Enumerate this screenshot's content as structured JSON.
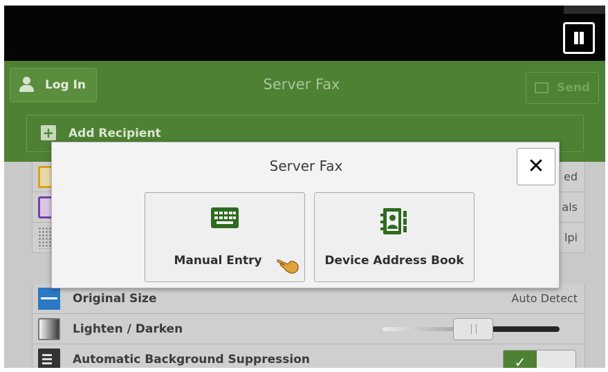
{
  "header": {
    "login_label": "Log In",
    "title": "Server Fax",
    "send_label": "Send"
  },
  "add_recipient_label": "Add Recipient",
  "settings": [
    {
      "label": "",
      "value": "ed",
      "icon": "two-sided-icon"
    },
    {
      "label": "",
      "value": "als",
      "icon": "color-mode-icon"
    },
    {
      "label": "",
      "value": "lpi",
      "icon": "resolution-icon"
    },
    {
      "label": "Original Size",
      "value": "Auto Detect",
      "icon": "original-size-icon"
    },
    {
      "label": "Lighten / Darken",
      "value": "",
      "icon": "lighten-darken-icon"
    },
    {
      "label": "Automatic Background Suppression",
      "value": "",
      "icon": "background-suppression-icon"
    }
  ],
  "modal": {
    "title": "Server Fax",
    "close_label": "✕",
    "options": [
      {
        "label": "Manual Entry",
        "icon": "keyboard-icon"
      },
      {
        "label": "Device Address Book",
        "icon": "address-book-icon"
      }
    ]
  },
  "colors": {
    "header_green": "#4e8133",
    "icon_green": "#2e6b1f",
    "modal_bg": "#f3f3f3"
  },
  "lighten_darken_level": 0.45,
  "background_suppression_on": true
}
